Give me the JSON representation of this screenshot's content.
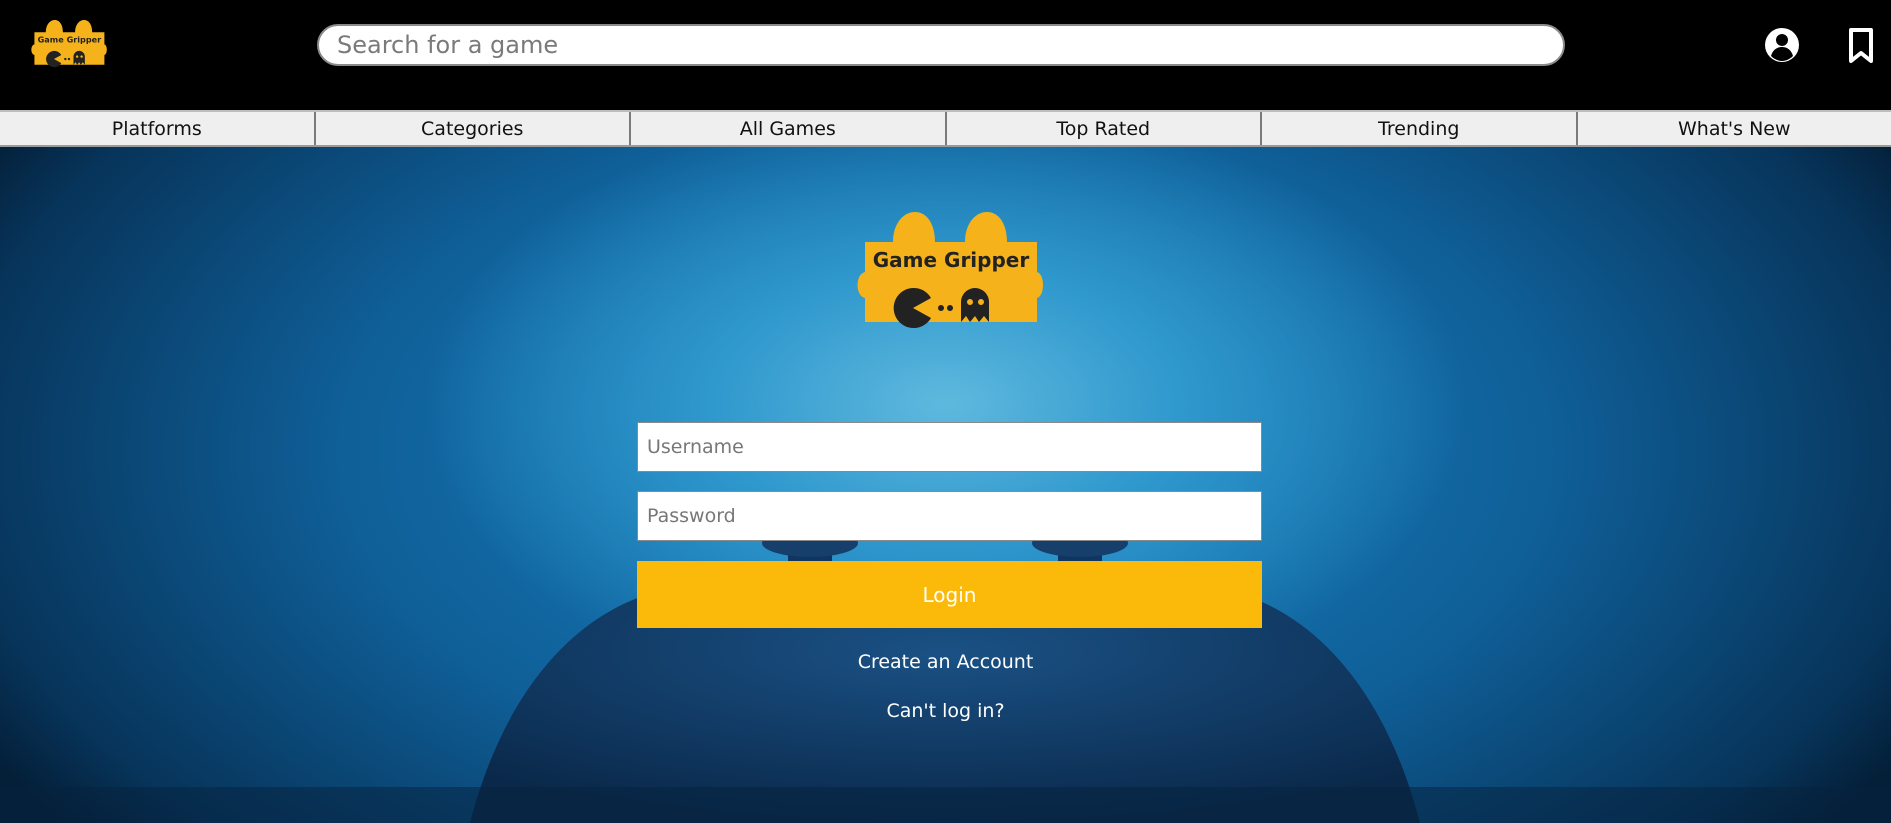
{
  "header": {
    "logo_text": "Game Gripper",
    "search_placeholder": "Search for a game",
    "icons": [
      "user-account-icon",
      "bookmark-icon"
    ]
  },
  "nav": {
    "items": [
      {
        "label": "Platforms"
      },
      {
        "label": "Categories"
      },
      {
        "label": "All Games"
      },
      {
        "label": "Top Rated"
      },
      {
        "label": "Trending"
      },
      {
        "label": "What's New"
      }
    ]
  },
  "login": {
    "logo_text": "Game Gripper",
    "username_placeholder": "Username",
    "password_placeholder": "Password",
    "login_label": "Login",
    "create_account_label": "Create an Account",
    "cant_login_label": "Can't log in?"
  },
  "colors": {
    "accent": "#fbba09",
    "header_bg": "#000000",
    "nav_bg": "#efefef",
    "hero_blue": "#1b86c4"
  }
}
